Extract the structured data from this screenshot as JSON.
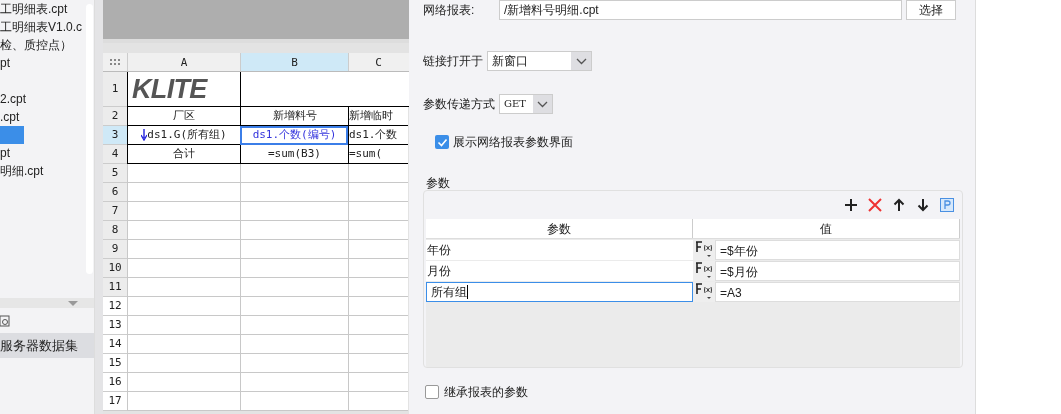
{
  "file_tree": {
    "items": [
      {
        "label": "工明细表.cpt",
        "selected": false
      },
      {
        "label": "工明细表V1.0.c",
        "selected": false
      },
      {
        "label": "检、质控点）",
        "selected": false
      },
      {
        "label": "pt",
        "selected": false
      },
      {
        "label": "2.cpt",
        "selected": false
      },
      {
        "label": ".cpt",
        "selected": false
      },
      {
        "selected": true
      },
      {
        "label": "pt",
        "selected": false
      },
      {
        "label": "明细.cpt",
        "selected": false
      }
    ]
  },
  "dataset_panel": {
    "item": "服务器数据集"
  },
  "sheet": {
    "columns": [
      {
        "label": "A",
        "selected": false
      },
      {
        "label": "B",
        "selected": true
      },
      {
        "label": "C",
        "selected": false
      }
    ],
    "rows": [
      {
        "header": "1",
        "selected": false,
        "kind": "logo",
        "logo": "KLITE"
      },
      {
        "header": "2",
        "selected": false,
        "kind": "cells",
        "cells": [
          "厂区",
          "新增料号",
          "新增临时"
        ]
      },
      {
        "header": "3",
        "selected": true,
        "kind": "cells",
        "cells": [
          "ds1.G(所有组)",
          "ds1.个数(编号)",
          "ds1.个数"
        ]
      },
      {
        "header": "4",
        "selected": false,
        "kind": "cells",
        "cells": [
          "合计",
          "=sum(B3)",
          "=sum("
        ]
      },
      {
        "header": "5",
        "selected": false,
        "kind": "empty"
      },
      {
        "header": "6",
        "selected": false,
        "kind": "empty"
      },
      {
        "header": "7",
        "selected": false,
        "kind": "empty"
      },
      {
        "header": "8",
        "selected": false,
        "kind": "empty"
      },
      {
        "header": "9",
        "selected": false,
        "kind": "empty"
      },
      {
        "header": "10",
        "selected": false,
        "kind": "empty"
      },
      {
        "header": "11",
        "selected": false,
        "kind": "empty"
      },
      {
        "header": "12",
        "selected": false,
        "kind": "empty"
      },
      {
        "header": "13",
        "selected": false,
        "kind": "empty"
      },
      {
        "header": "14",
        "selected": false,
        "kind": "empty"
      },
      {
        "header": "15",
        "selected": false,
        "kind": "empty"
      },
      {
        "header": "16",
        "selected": false,
        "kind": "empty"
      },
      {
        "header": "17",
        "selected": false,
        "kind": "empty"
      }
    ]
  },
  "link_settings": {
    "report_label": "网络报表:",
    "report_path": "/新增料号明细.cpt",
    "choose_button": "选择",
    "open_in_label": "链接打开于",
    "open_in_value": "新窗口",
    "method_label": "参数传递方式",
    "method_value": "GET",
    "show_params": {
      "label": "展示网络报表参数界面",
      "checked": true
    },
    "params": {
      "title": "参数",
      "columns": [
        "参数",
        "值"
      ],
      "rows": [
        {
          "name": "年份",
          "value": "=$年份",
          "editing": false
        },
        {
          "name": "月份",
          "value": "=$月份",
          "editing": false
        },
        {
          "name": "所有组",
          "value": "=A3",
          "editing": true
        }
      ]
    },
    "inherit_params": {
      "label": "继承报表的参数",
      "checked": false
    }
  }
}
